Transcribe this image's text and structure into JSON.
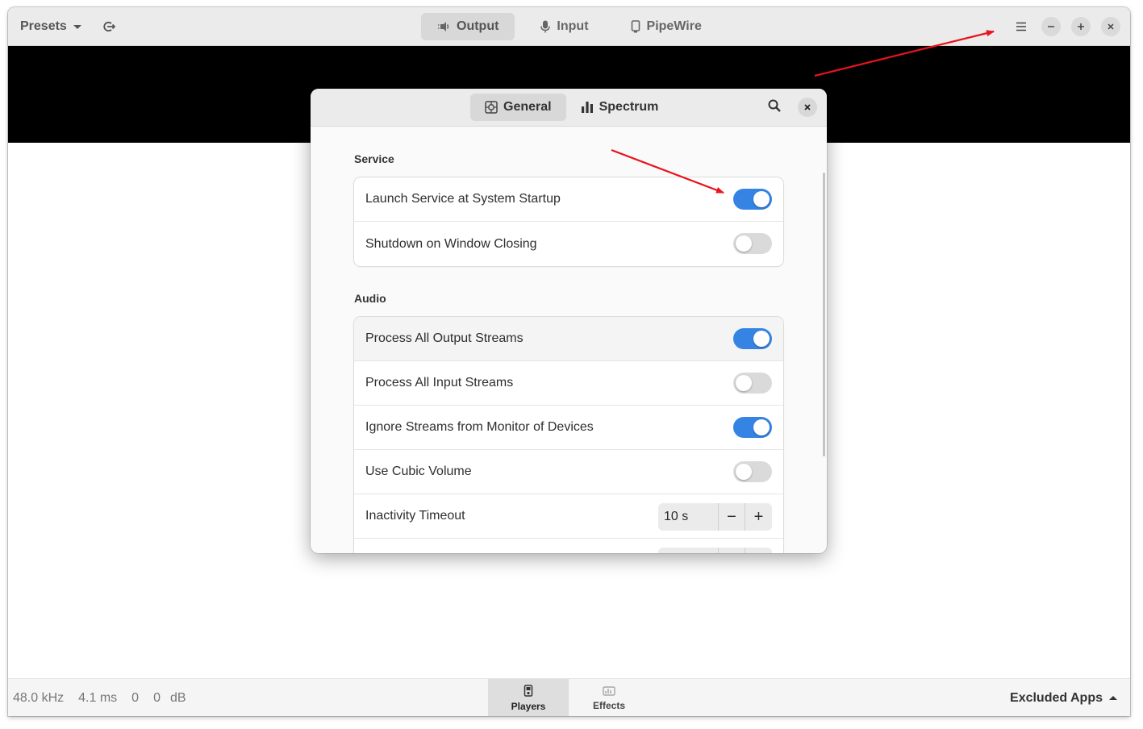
{
  "header": {
    "presets_label": "Presets",
    "tabs": [
      {
        "label": "Output",
        "icon": "speaker-icon",
        "active": true
      },
      {
        "label": "Input",
        "icon": "microphone-icon",
        "active": false
      },
      {
        "label": "PipeWire",
        "icon": "device-icon",
        "active": false
      }
    ]
  },
  "footer": {
    "sample_rate": "48.0 kHz",
    "latency": "4.1 ms",
    "level_left": "0",
    "level_right": "0",
    "level_unit": "dB",
    "stack": [
      {
        "label": "Players",
        "icon": "player-icon",
        "active": true
      },
      {
        "label": "Effects",
        "icon": "effects-icon",
        "active": false
      }
    ],
    "excluded_label": "Excluded Apps"
  },
  "dialog": {
    "tabs": [
      {
        "label": "General",
        "icon": "settings-icon",
        "active": true
      },
      {
        "label": "Spectrum",
        "icon": "spectrum-icon",
        "active": false
      }
    ],
    "sections": {
      "service": {
        "title": "Service",
        "rows": [
          {
            "label": "Launch Service at System Startup",
            "on": true
          },
          {
            "label": "Shutdown on Window Closing",
            "on": false
          }
        ]
      },
      "audio": {
        "title": "Audio",
        "rows": [
          {
            "label": "Process All Output Streams",
            "on": true
          },
          {
            "label": "Process All Input Streams",
            "on": false
          },
          {
            "label": "Ignore Streams from Monitor of Devices",
            "on": true
          },
          {
            "label": "Use Cubic Volume",
            "on": false
          }
        ],
        "inactivity": {
          "label": "Inactivity Timeout",
          "value": "10 s",
          "minus": "−",
          "plus": "+"
        }
      }
    }
  },
  "colors": {
    "accent": "#3584e4",
    "annotation": "#e8141e"
  }
}
